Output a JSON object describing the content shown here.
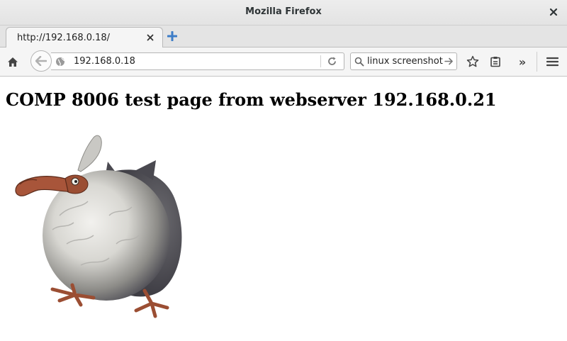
{
  "window": {
    "title": "Mozilla Firefox",
    "close_icon": "close-icon"
  },
  "tabs": [
    {
      "label": "http://192.168.0.18/",
      "close_icon": "close-icon"
    }
  ],
  "newtab_icon": "plus-icon",
  "navbar": {
    "home_icon": "home-icon",
    "back_icon": "back-arrow-icon",
    "url": "192.168.0.18",
    "reload_icon": "reload-icon",
    "search_value": "linux screenshot",
    "search_icon": "search-icon",
    "search_go_icon": "arrow-right-icon",
    "bookmark_icon": "star-icon",
    "reading_list_icon": "clipboard-icon",
    "overflow_label": "»",
    "menu_icon": "hamburger-menu-icon"
  },
  "page": {
    "heading": "COMP 8006 test page from webserver 192.168.0.21"
  },
  "colors": {
    "newtab_accent": "#3d7dc7",
    "chrome_bg": "#e4e4e4",
    "navbar_bg": "#f5f5f5"
  }
}
